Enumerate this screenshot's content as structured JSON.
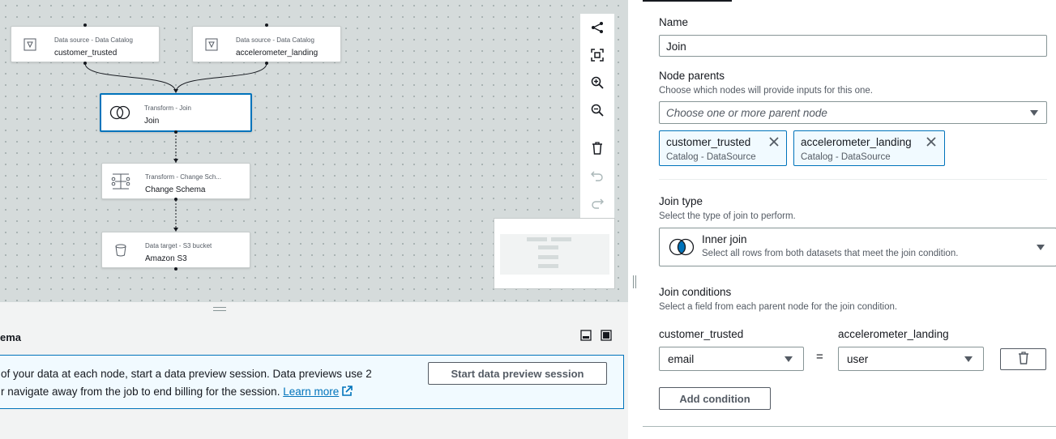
{
  "canvas": {
    "nodes": [
      {
        "id": "customer_trusted",
        "type_label": "Data source - Data Catalog",
        "name": "customer_trusted",
        "icon": "data-catalog-icon"
      },
      {
        "id": "accelerometer_landing",
        "type_label": "Data source - Data Catalog",
        "name": "accelerometer_landing",
        "icon": "data-catalog-icon"
      },
      {
        "id": "join",
        "type_label": "Transform - Join",
        "name": "Join",
        "icon": "join-icon",
        "selected": true
      },
      {
        "id": "change_schema",
        "type_label": "Transform - Change Sch...",
        "name": "Change Schema",
        "icon": "change-schema-icon"
      },
      {
        "id": "s3",
        "type_label": "Data target - S3 bucket",
        "name": "Amazon S3",
        "icon": "bucket-icon"
      }
    ],
    "toolbar": [
      "layout-icon",
      "fit-screen-icon",
      "zoom-in-icon",
      "zoom-out-icon",
      "delete-icon",
      "undo-icon",
      "redo-icon"
    ]
  },
  "bottom_panel": {
    "title": "ema",
    "info_line1": "of your data at each node, start a data preview session. Data previews use 2",
    "info_line2": "r navigate away from the job to end billing for the session.",
    "learn_more": "Learn more",
    "start_preview_label": "Start data preview session"
  },
  "node_props": {
    "name_label": "Name",
    "name_value": "Join",
    "parents_label": "Node parents",
    "parents_desc": "Choose which nodes will provide inputs for this one.",
    "parents_placeholder": "Choose one or more parent node",
    "parents": [
      {
        "name": "customer_trusted",
        "sub": "Catalog - DataSource"
      },
      {
        "name": "accelerometer_landing",
        "sub": "Catalog - DataSource"
      }
    ],
    "join_type_label": "Join type",
    "join_type_desc": "Select the type of join to perform.",
    "join_type_value": "Inner join",
    "join_type_value_desc": "Select all rows from both datasets that meet the join condition.",
    "join_conditions_label": "Join conditions",
    "join_conditions_desc": "Select a field from each parent node for the join condition.",
    "left_parent": "customer_trusted",
    "right_parent": "accelerometer_landing",
    "left_field": "email",
    "equals": "=",
    "right_field": "user",
    "add_condition_label": "Add condition"
  }
}
